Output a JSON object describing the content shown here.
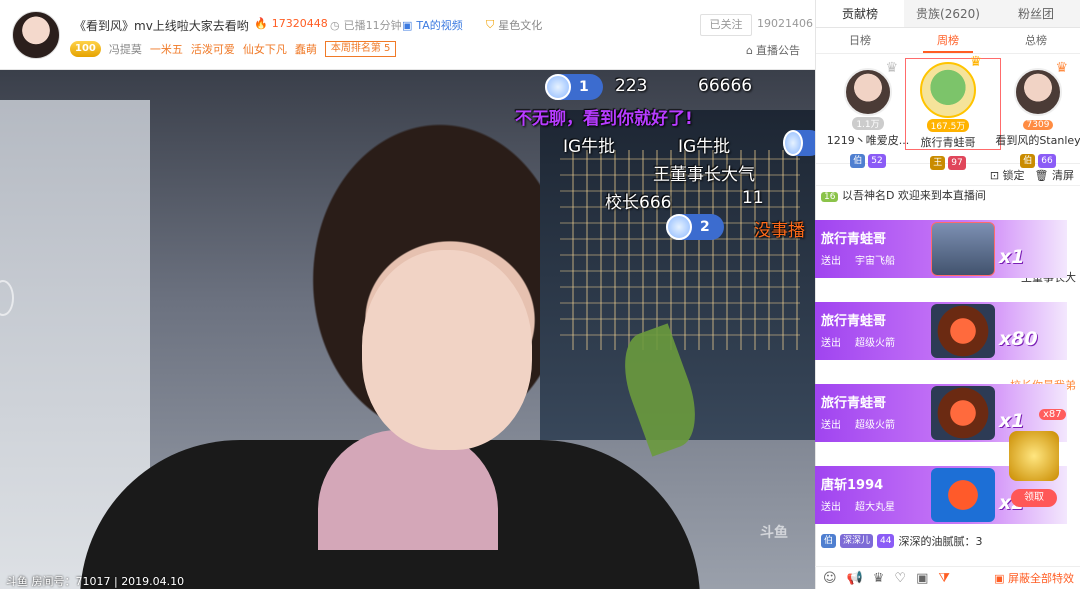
{
  "header": {
    "title": "《看到风》mv上线啦大家去看哟",
    "heat": "17320448",
    "live_time": "已播11分钟",
    "ta_video": "TA的视频",
    "agency": "星色文化",
    "followed_label": "已关注",
    "follow_count": "19021406",
    "level": "100",
    "anchor_name": "冯提莫",
    "tags": [
      "一米五",
      "活泼可爱",
      "仙女下凡",
      "蠢萌"
    ],
    "rank_tag": "本周排名第 5",
    "announce": "直播公告"
  },
  "video": {
    "danmu": {
      "purple": "不无聊，看到你就好了!",
      "line1a": "IG牛批",
      "line1b": "IG牛批",
      "line2": "王董事长大气",
      "line3": "校长666",
      "line3b": "11",
      "orange": "没事播"
    },
    "rank_pill_1": {
      "rank": "1",
      "count": "223",
      "score": "66666"
    },
    "rank_pill_2": {
      "rank": "2"
    },
    "watermark": "斗鱼",
    "bottom_info": "斗鱼 房间号：71017 | 2019.04.10"
  },
  "panel": {
    "tabs": [
      "贡献榜",
      "贵族(2620)",
      "粉丝团"
    ],
    "subtabs": [
      "日榜",
      "周榜",
      "总榜"
    ],
    "podium": [
      {
        "name": "1219丶唯爱皮...",
        "score": "1.1万",
        "lv": "伯",
        "fan": "52"
      },
      {
        "name": "旅行青蛙哥",
        "score": "167.5万",
        "lv": "王",
        "fan": "97"
      },
      {
        "name": "看到风的Stanley",
        "score": "7309",
        "lv": "伯",
        "fan": "66"
      }
    ],
    "lock": "锁定",
    "clear": "清屏",
    "msg1_fan": "16",
    "msg1_text": "以吾神名D  欢迎来到本直播间",
    "partial1": "王董事长大",
    "partial2": "校长你最我弟",
    "gifts": [
      {
        "user": "旅行青蛙哥",
        "action": "送出",
        "item": "宇宙飞船",
        "count": "x1"
      },
      {
        "user": "旅行青蛙哥",
        "action": "送出",
        "item": "超级火箭",
        "count": "x80"
      },
      {
        "user": "旅行青蛙哥",
        "action": "送出",
        "item": "超级火箭",
        "count": "x1"
      },
      {
        "user": "唐斩1994",
        "action": "送出",
        "item": "超大丸星",
        "count": "x2"
      }
    ],
    "treasure_count": "x87",
    "treasure_btn": "领取",
    "last_user": "深深儿",
    "last_fan": "44",
    "last_text": "深深的油腻腻：3",
    "block_fx": "屏蔽全部特效"
  }
}
